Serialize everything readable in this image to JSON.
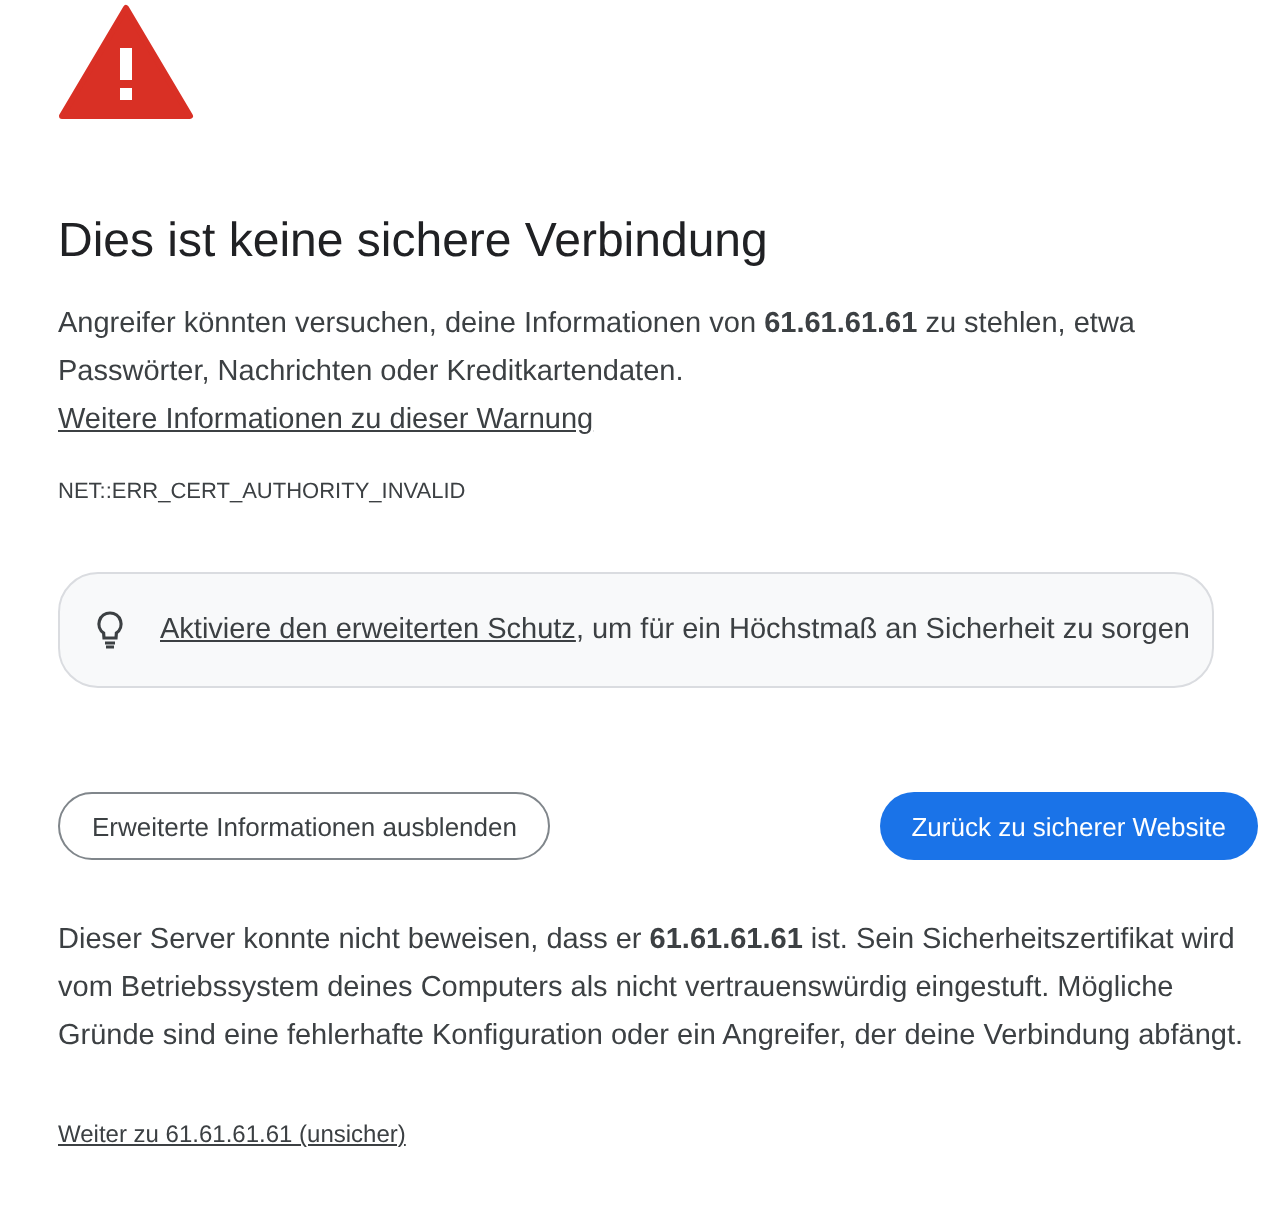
{
  "title": "Dies ist keine sichere Verbindung",
  "intro": {
    "text": "Angreifer könnten versuchen, deine Informationen von **61.61.61.61** zu stehlen, etwa Passwörter, Nachrichten oder Kreditkartendaten.",
    "link": "Weitere Informationen zu dieser Warnung"
  },
  "error_code": "NET::ERR_CERT_AUTHORITY_INVALID",
  "protection_hint": {
    "link": "Aktiviere den erweiterten Schutz",
    "text": ", um für ein Höchstmaß an Sicherheit zu sorgen"
  },
  "buttons": [
    {
      "label": "Erweiterte Informationen ausblenden",
      "kind": "secondary"
    },
    {
      "label": "Zurück zu sicherer Website",
      "kind": "primary"
    }
  ],
  "details": "Dieser Server konnte nicht beweisen, dass er **61.61.61.61** ist. Sein Sicherheitszertifikat wird vom Betriebssystem deines Computers als nicht vertrauenswürdig eingestuft. Mögliche Gründe sind eine fehlerhafte Konfiguration oder ein Angreifer, der deine Verbindung abfängt.",
  "proceed_link": "Weiter zu 61.61.61.61 (unsicher)"
}
